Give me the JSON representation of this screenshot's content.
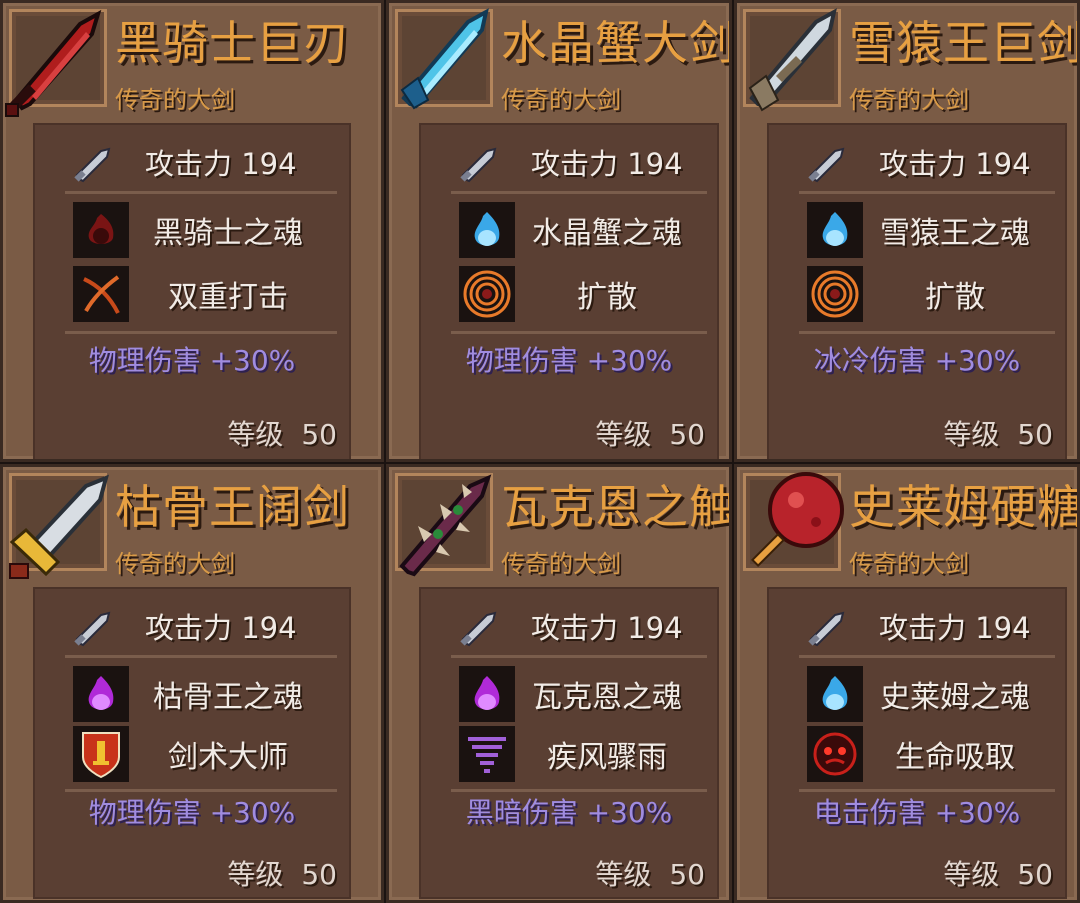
{
  "common": {
    "subtitle": "传奇的大剑",
    "attack": "攻击力 194",
    "level_label": "等级",
    "level_value": "50"
  },
  "cards": [
    {
      "name": "黑骑士巨刃",
      "weapon_icon": "black-knight-blade-icon",
      "soul": "黑骑士之魂",
      "soul_icon": "red-soul-flame-icon",
      "skill": "双重打击",
      "skill_icon": "double-strike-icon",
      "bonus": "物理伤害 +30%",
      "colors": {
        "blade": "#b01d1d",
        "accent": "#2a0c0c"
      }
    },
    {
      "name": "水晶蟹大剑",
      "weapon_icon": "crystal-crab-sword-icon",
      "soul": "水晶蟹之魂",
      "soul_icon": "blue-soul-flame-icon",
      "skill": "扩散",
      "skill_icon": "spread-rings-icon",
      "bonus": "物理伤害 +30%",
      "colors": {
        "blade": "#4fc4e8",
        "accent": "#1d5f8c"
      }
    },
    {
      "name": "雪猿王巨剑",
      "weapon_icon": "snow-ape-king-sword-icon",
      "soul": "雪猿王之魂",
      "soul_icon": "blue-soul-flame-icon",
      "skill": "扩散",
      "skill_icon": "spread-rings-icon",
      "bonus": "冰冷伤害 +30%",
      "colors": {
        "blade": "#cfd8df",
        "accent": "#7a6a52"
      }
    },
    {
      "name": "枯骨王阔剑",
      "weapon_icon": "bone-king-broadsword-icon",
      "soul": "枯骨王之魂",
      "soul_icon": "purple-soul-flame-icon",
      "skill": "剑术大师",
      "skill_icon": "sword-master-shield-icon",
      "bonus": "物理伤害 +30%",
      "colors": {
        "blade": "#d8dde3",
        "accent": "#e8b838"
      }
    },
    {
      "name": "瓦克恩之触",
      "weapon_icon": "vakorn-touch-icon",
      "soul": "瓦克恩之魂",
      "soul_icon": "purple-soul-flame-icon",
      "skill": "疾风骤雨",
      "skill_icon": "whirlwind-icon",
      "bonus": "黑暗伤害 +30%",
      "colors": {
        "blade": "#6a2a4a",
        "accent": "#d9c9b0"
      }
    },
    {
      "name": "史莱姆硬糖",
      "weapon_icon": "slime-candy-icon",
      "soul": "史莱姆之魂",
      "soul_icon": "blue-soul-flame-icon",
      "skill": "生命吸取",
      "skill_icon": "life-steal-icon",
      "bonus": "电击伤害 +30%",
      "colors": {
        "blade": "#b8232b",
        "accent": "#e8a040"
      }
    }
  ]
}
